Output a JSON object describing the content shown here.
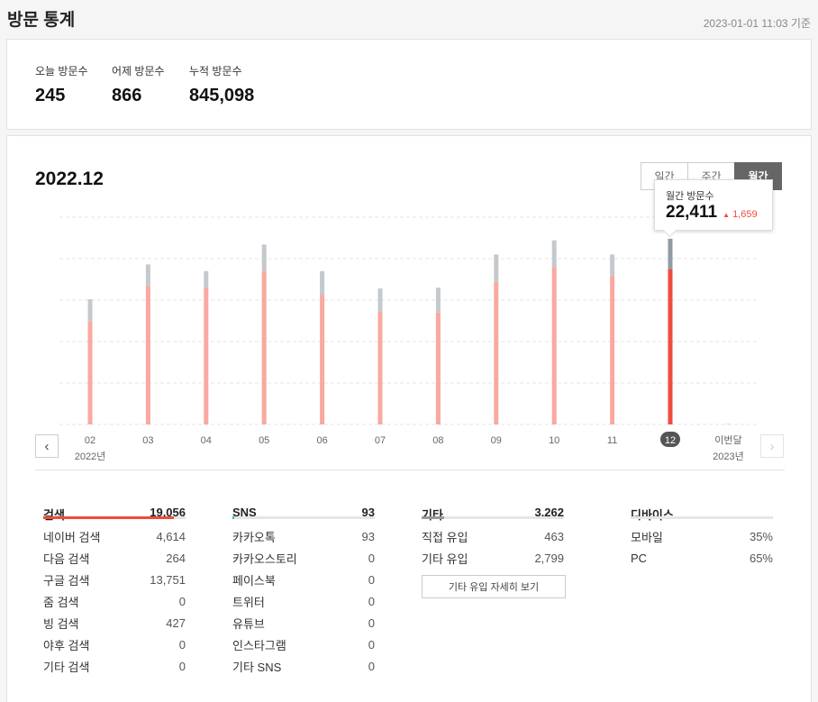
{
  "header": {
    "title": "방문 통계",
    "base_time": "2023-01-01 11:03 기준"
  },
  "summary": {
    "today_label": "오늘 방문수",
    "today_value": "245",
    "yesterday_label": "어제 방문수",
    "yesterday_value": "866",
    "total_label": "누적 방문수",
    "total_value": "845,098"
  },
  "period": {
    "title": "2022.12",
    "tabs": [
      "일간",
      "주간",
      "월간"
    ],
    "active_tab": "월간"
  },
  "tooltip": {
    "label": "월간 방문수",
    "value": "22,411",
    "delta": "1,659",
    "delta_arrow": "▲"
  },
  "colors": {
    "bar": "#f9a99f",
    "bar_top": "#c4c9cd",
    "selected": "#f04b3c",
    "selected_top": "#909ba3",
    "accent": "#f04b3c",
    "sns": "#1fc1b0",
    "etc": "#999999"
  },
  "chart_data": {
    "type": "bar",
    "categories": [
      "02",
      "03",
      "04",
      "05",
      "06",
      "07",
      "08",
      "09",
      "10",
      "11",
      "12",
      "이번달"
    ],
    "sublabels": [
      "2022년",
      "",
      "",
      "",
      "",
      "",
      "",
      "",
      "",
      "",
      "",
      "2023년"
    ],
    "series": [
      {
        "values": [
          12400,
          16700,
          16500,
          18500,
          15600,
          13600,
          13500,
          17200,
          19000,
          17900,
          18700,
          50
        ]
      },
      {
        "values": [
          2700,
          2600,
          2000,
          3200,
          2900,
          2800,
          3000,
          3300,
          3200,
          2600,
          3700,
          0
        ]
      }
    ],
    "selected_index": 10,
    "ylim": [
      0,
      25000
    ],
    "grid": true
  },
  "nav": {
    "prev": "‹",
    "next": "›"
  },
  "stats": {
    "search": {
      "title": "검색",
      "total": "19,056",
      "fill": 0.92,
      "rows": [
        {
          "label": "네이버 검색",
          "value": "4,614"
        },
        {
          "label": "다음 검색",
          "value": "264"
        },
        {
          "label": "구글 검색",
          "value": "13,751"
        },
        {
          "label": "줌 검색",
          "value": "0"
        },
        {
          "label": "빙 검색",
          "value": "427"
        },
        {
          "label": "야후 검색",
          "value": "0"
        },
        {
          "label": "기타 검색",
          "value": "0"
        }
      ]
    },
    "sns": {
      "title": "SNS",
      "total": "93",
      "fill": 0.01,
      "rows": [
        {
          "label": "카카오톡",
          "value": "93"
        },
        {
          "label": "카카오스토리",
          "value": "0"
        },
        {
          "label": "페이스북",
          "value": "0"
        },
        {
          "label": "트위터",
          "value": "0"
        },
        {
          "label": "유튜브",
          "value": "0"
        },
        {
          "label": "인스타그램",
          "value": "0"
        },
        {
          "label": "기타 SNS",
          "value": "0"
        }
      ]
    },
    "etc": {
      "title": "기타",
      "total": "3,262",
      "fill": 0.16,
      "rows": [
        {
          "label": "직접 유입",
          "value": "463"
        },
        {
          "label": "기타 유입",
          "value": "2,799"
        }
      ],
      "detail_button": "기타 유입 자세히 보기"
    },
    "device": {
      "title": "디바이스",
      "rows": [
        {
          "label": "모바일",
          "value": "35%"
        },
        {
          "label": "PC",
          "value": "65%"
        }
      ]
    }
  }
}
